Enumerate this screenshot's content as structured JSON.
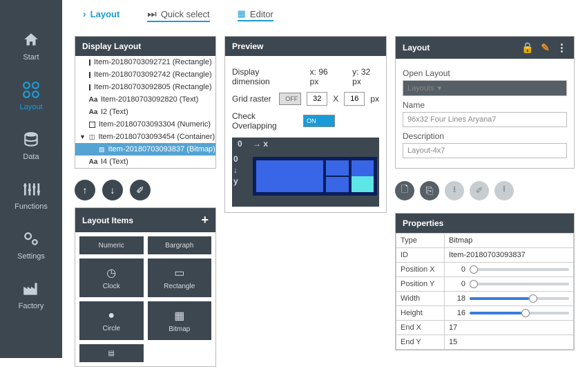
{
  "topTabs": {
    "layout": "Layout",
    "quick": "Quick select",
    "editor": "Editor"
  },
  "sidebar": [
    {
      "label": "Start"
    },
    {
      "label": "Layout"
    },
    {
      "label": "Data"
    },
    {
      "label": "Functions"
    },
    {
      "label": "Settings"
    },
    {
      "label": "Factory"
    }
  ],
  "displayLayout": {
    "title": "Display Layout",
    "tree": [
      {
        "icon": "sq",
        "label": "Item-20180703092721 (Rectangle)",
        "indent": 1
      },
      {
        "icon": "sq",
        "label": "Item-20180703092742 (Rectangle)",
        "indent": 1
      },
      {
        "icon": "sq",
        "label": "Item-20180703092805 (Rectangle)",
        "indent": 1
      },
      {
        "icon": "aa",
        "label": "Item-20180703092820 (Text)",
        "indent": 1
      },
      {
        "icon": "aa",
        "label": "I2 (Text)",
        "indent": 1
      },
      {
        "icon": "sq",
        "label": "Item-20180703093304 (Numeric)",
        "indent": 1
      },
      {
        "icon": "tri",
        "label": "Item-20180703093454 (Container)",
        "indent": 0,
        "expand": true
      },
      {
        "icon": "img",
        "label": "Item-20180703093837 (Bitmap)",
        "indent": 2,
        "selected": true
      },
      {
        "icon": "aa",
        "label": "I4 (Text)",
        "indent": 1
      }
    ]
  },
  "layoutItems": {
    "title": "Layout Items",
    "tiles": [
      "Numeric",
      "Bargraph",
      "Clock",
      "Rectangle",
      "Circle",
      "Bitmap"
    ]
  },
  "preview": {
    "title": "Preview",
    "dimLabel": "Display dimension",
    "dimX": "x: 96 px",
    "dimY": "y: 32 px",
    "gridLabel": "Grid raster",
    "gridOff": "OFF",
    "grid1": "32",
    "gridX": "X",
    "grid2": "16",
    "gridPx": "px",
    "overlapLabel": "Check Overlapping",
    "on": "ON"
  },
  "layoutPanel": {
    "title": "Layout",
    "openLabel": "Open Layout",
    "dropdown": "Layouts",
    "nameLabel": "Name",
    "nameValue": "96x32 Four Lines Aryana7",
    "descLabel": "Description",
    "descValue": "Layout-4x7"
  },
  "properties": {
    "title": "Properties",
    "rows": [
      {
        "k": "Type",
        "v": "Bitmap"
      },
      {
        "k": "ID",
        "v": "Item-20180703093837"
      },
      {
        "k": "Position X",
        "v": "0",
        "slider": 0
      },
      {
        "k": "Position Y",
        "v": "0",
        "slider": 0
      },
      {
        "k": "Width",
        "v": "18",
        "slider": 60
      },
      {
        "k": "Height",
        "v": "16",
        "slider": 52
      },
      {
        "k": "End X",
        "v": "17"
      },
      {
        "k": "End Y",
        "v": "15"
      }
    ]
  }
}
